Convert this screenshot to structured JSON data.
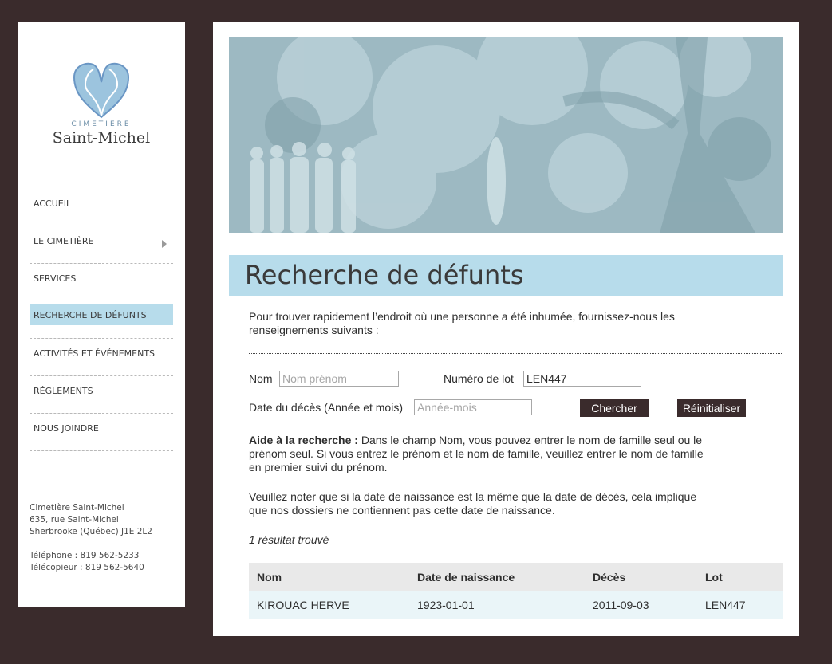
{
  "sidebar": {
    "logo": {
      "small": "CIMETIÈRE",
      "big": "Saint-Michel"
    },
    "nav": [
      {
        "label": "ACCUEIL"
      },
      {
        "label": "LE CIMETIÈRE",
        "has_submenu": true
      },
      {
        "label": "SERVICES"
      },
      {
        "label": "RECHERCHE DE DÉFUNTS",
        "active": true
      },
      {
        "label": "ACTIVITÉS ET ÉVÉNEMENTS"
      },
      {
        "label": "RÉGLEMENTS"
      },
      {
        "label": "NOUS JOINDRE"
      }
    ],
    "address": {
      "line1": "Cimetière Saint-Michel",
      "line2": "635, rue Saint-Michel",
      "line3": "Sherbrooke (Québec)  J1E 2L2",
      "phone": "Téléphone : 819 562-5233",
      "fax": "Télécopieur : 819 562-5640"
    }
  },
  "main": {
    "title": "Recherche de défunts",
    "intro": "Pour trouver rapidement l’endroit où une personne a été inhumée, fournissez-nous les renseignements suivants :",
    "form": {
      "name_label": "Nom",
      "name_placeholder": "Nom prénom",
      "lot_label": "Numéro de lot",
      "lot_value": "LEN447",
      "date_label": "Date du décès (Année et mois)",
      "date_placeholder": "Année-mois",
      "search_button": "Chercher",
      "reset_button": "Réinitialiser"
    },
    "help": {
      "bold": "Aide à la recherche :",
      "text": " Dans le champ Nom, vous pouvez entrer le nom de famille seul ou le prénom seul. Si vous entrez le prénom et le nom de famille, veuillez entrer le nom de famille en premier suivi du prénom."
    },
    "note": "Veuillez noter que si la date de naissance est la même que la date de décès, cela implique que nos dossiers ne contiennent pas cette date de naissance.",
    "result_count": "1 résultat trouvé",
    "table": {
      "headers": [
        "Nom",
        "Date de naissance",
        "Décès",
        "Lot"
      ],
      "rows": [
        [
          "KIROUAC HERVE",
          "1923-01-01",
          "2011-09-03",
          "LEN447"
        ]
      ]
    }
  },
  "colors": {
    "background": "#3a2b2c",
    "accent": "#b7dceb",
    "banner": "#9ab7c0",
    "button": "#3a2b2c"
  }
}
